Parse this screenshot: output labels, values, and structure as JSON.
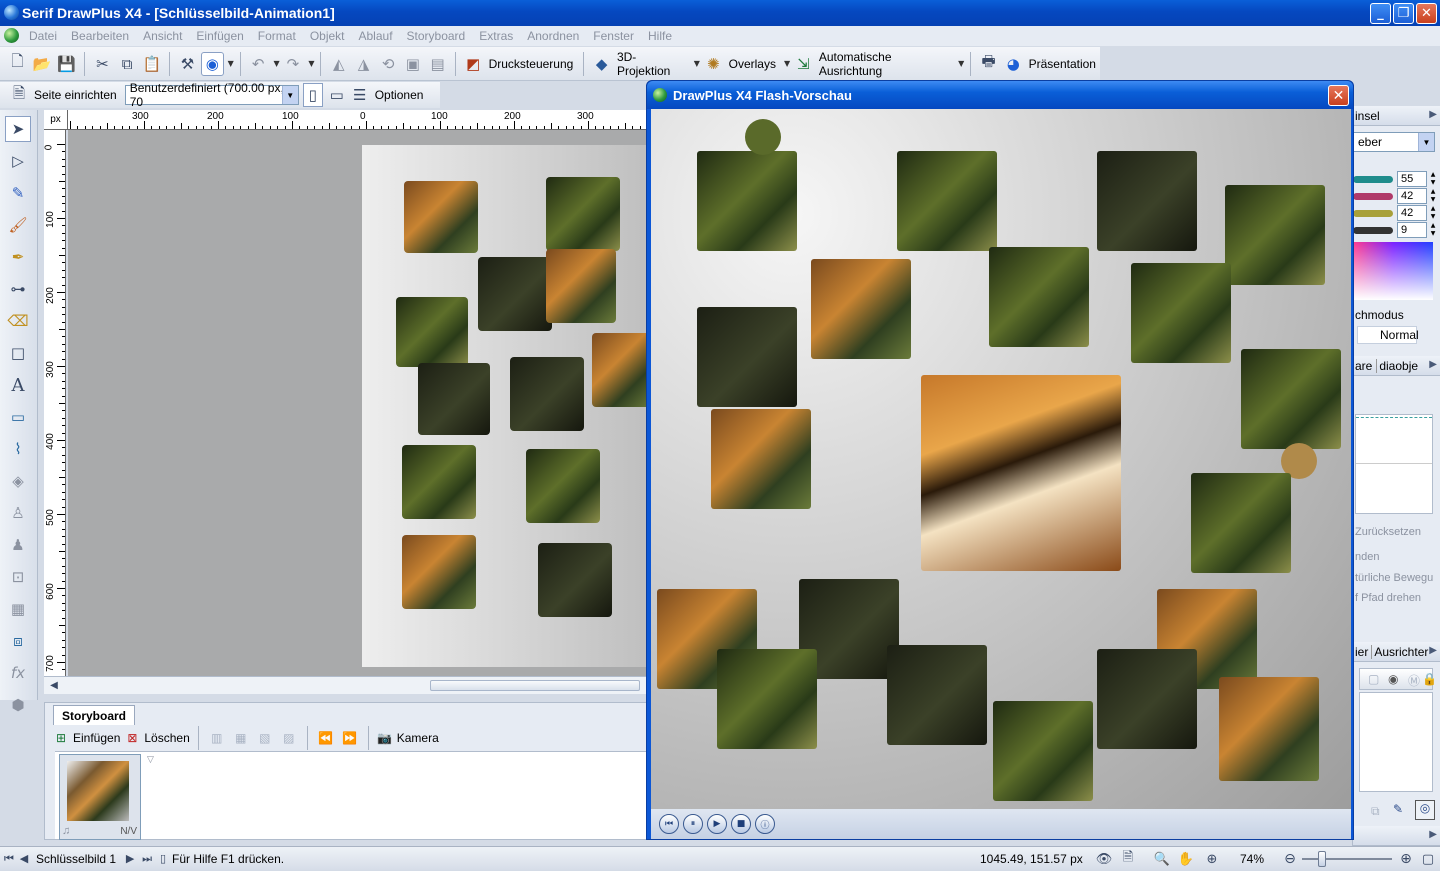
{
  "window": {
    "title": "Serif DrawPlus X4 - [Schlüsselbild-Animation1]",
    "minimize": "_",
    "restore": "❐",
    "close": "✕"
  },
  "menu": [
    "Datei",
    "Bearbeiten",
    "Ansicht",
    "Einfügen",
    "Format",
    "Objekt",
    "Ablauf",
    "Storyboard",
    "Extras",
    "Anordnen",
    "Fenster",
    "Hilfe"
  ],
  "toolbar": {
    "print_control": "Drucksteuerung",
    "projection_3d": "3D-Projektion",
    "overlays": "Overlays",
    "auto_align": "Automatische Ausrichtung",
    "presentation": "Präsentation"
  },
  "context": {
    "page_setup": "Seite einrichten",
    "page_size": "Benutzerdefiniert (700.00 px, 70",
    "options": "Optionen"
  },
  "ruler": {
    "unit": "px",
    "h_ticks": [
      "300",
      "200",
      "100",
      "0",
      "100",
      "200",
      "300"
    ],
    "v_ticks": [
      "0",
      "100",
      "200",
      "300",
      "400",
      "500",
      "600",
      "700"
    ]
  },
  "storyboard": {
    "tab": "Storyboard",
    "insert": "Einfügen",
    "delete": "Löschen",
    "camera": "Kamera",
    "frame_label": "N/V"
  },
  "flash_preview": {
    "title": "DrawPlus X4 Flash-Vorschau"
  },
  "right_panel": {
    "brush_tab": "insel",
    "color_mode": "eber",
    "values": [
      "55",
      "42",
      "42",
      "9"
    ],
    "slider_colors": [
      "#1f8c8c",
      "#b03a6a",
      "#a8a03a",
      "#333333"
    ],
    "blend_mode_label": "chmodus",
    "blend_mode": "Normal",
    "tabs2": [
      "are",
      "diaobje"
    ],
    "reset": "Zurücksetzen",
    "opt1": "nden",
    "opt2": "türliche Bewegu",
    "opt3": "f Pfad drehen",
    "tabs3": [
      "ier",
      "Ausrichter"
    ]
  },
  "status": {
    "keyframe": "Schlüsselbild 1",
    "help": "Für Hilfe F1 drücken.",
    "coords": "1045.49, 151.57 px",
    "zoom": "74%"
  }
}
